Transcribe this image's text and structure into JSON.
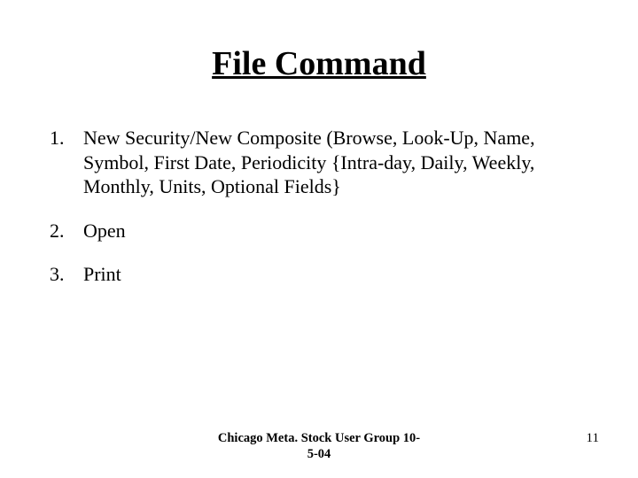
{
  "title": "File Command",
  "items": [
    "New Security/New Composite (Browse, Look-Up, Name, Symbol, First Date, Periodicity {Intra-day, Daily, Weekly, Monthly, Units, Optional Fields}",
    "Open",
    "Print"
  ],
  "footer": {
    "center": "Chicago Meta. Stock User Group 10-\n5-04",
    "page_number": "11"
  }
}
